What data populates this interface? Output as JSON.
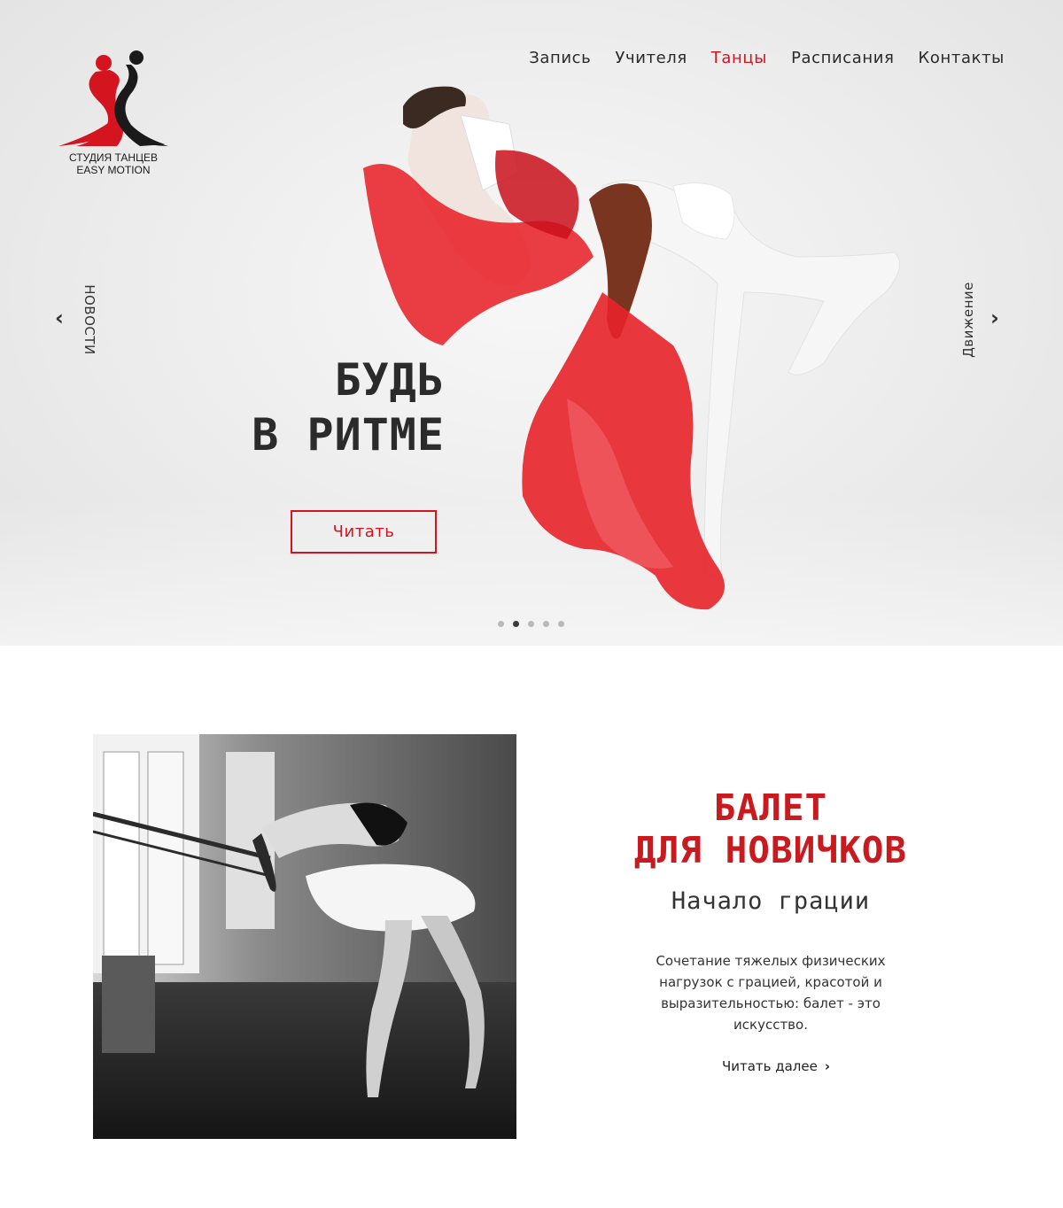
{
  "logo": {
    "line1": "СТУДИЯ ТАНЦЕВ",
    "line2": "EASY MOTION"
  },
  "nav": {
    "items": [
      {
        "label": "Запись"
      },
      {
        "label": "Учителя"
      },
      {
        "label": "Танцы",
        "active": true
      },
      {
        "label": "Расписания"
      },
      {
        "label": "Контакты"
      }
    ]
  },
  "hero": {
    "prev_label": "НОВОСТИ",
    "next_label": "Движение",
    "prev_arrow": "‹",
    "next_arrow": "›",
    "headline_line1": "БУДЬ",
    "headline_line2": "В РИТМЕ",
    "cta_label": "Читать",
    "slides_total": 5,
    "slide_active": 2
  },
  "article": {
    "title_line1": "БАЛЕТ",
    "title_line2": "ДЛЯ НОВИЧКОВ",
    "subtitle": "Начало грации",
    "body": "Сочетание тяжелых физических нагрузок с грацией, красотой и выразительностью: балет - это искусство.",
    "read_more": "Читать далее",
    "read_more_icon": "chevron-right-icon"
  },
  "colors": {
    "accent": "#d4141e",
    "title_red": "#c81a1f",
    "text": "#2b2b2b"
  }
}
